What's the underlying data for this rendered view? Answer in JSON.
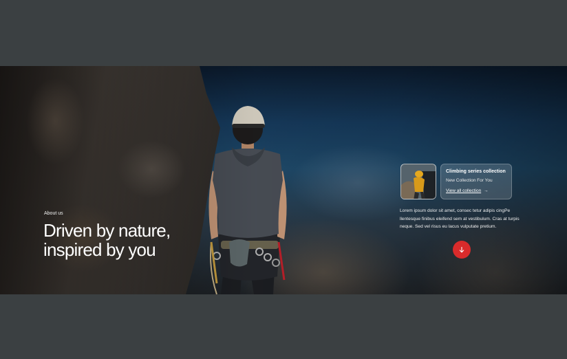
{
  "hero": {
    "eyebrow": "About us",
    "headline": "Driven by nature, inspired by you"
  },
  "collection_card": {
    "title": "Climbing series collection",
    "subtitle": "New Collection For You",
    "link_label": "View all collection",
    "link_arrow": "→"
  },
  "description": "Lorem ipsum dolor sit amet, consec tetur adipis cingPe llentesque finibus eleifend sem at vestibulum. Cras at turpis neque. Sed vel risus eu lacus vulputate pretium.",
  "scroll_button": {
    "icon": "arrow-down-icon"
  },
  "colors": {
    "page_background": "#3b4042",
    "accent": "#d92b2b",
    "text": "#ffffff"
  }
}
